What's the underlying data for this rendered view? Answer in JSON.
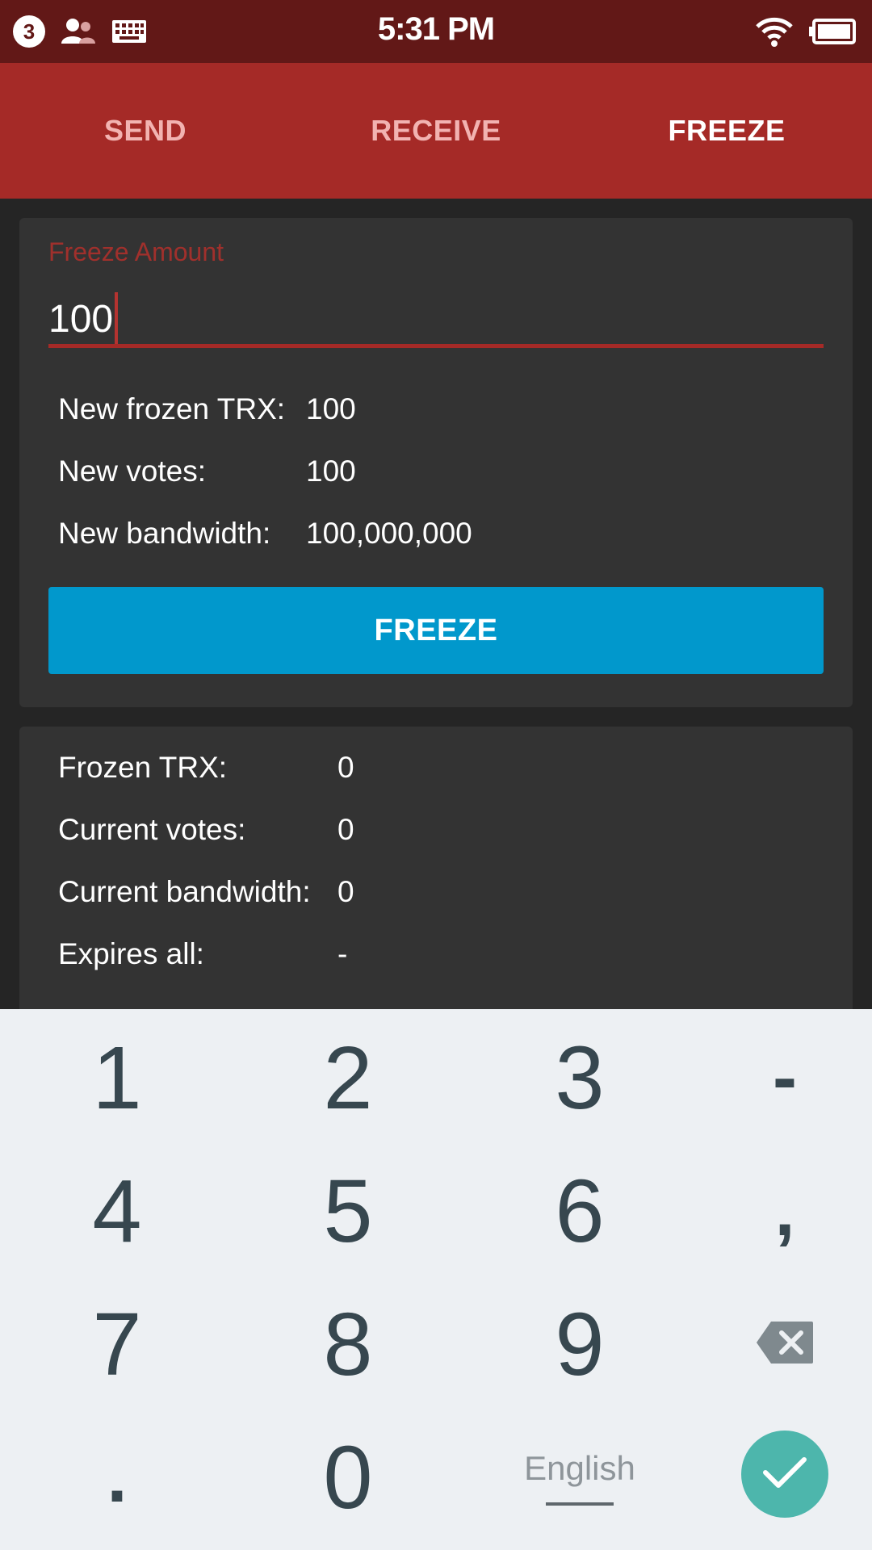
{
  "status_bar": {
    "notification_count": "3",
    "time": "5:31 PM",
    "icons": [
      "contacts-icon",
      "keyboard-icon",
      "wifi-icon",
      "battery-icon"
    ]
  },
  "tabs": [
    {
      "label": "SEND",
      "active": false
    },
    {
      "label": "RECEIVE",
      "active": false
    },
    {
      "label": "FREEZE",
      "active": true
    }
  ],
  "freeze_form": {
    "field_label": "Freeze Amount",
    "amount_value": "100",
    "new_frozen_label": "New frozen TRX:",
    "new_frozen_value": "100",
    "new_votes_label": "New votes:",
    "new_votes_value": "100",
    "new_bandwidth_label": "New bandwidth:",
    "new_bandwidth_value": "100,000,000",
    "button_label": "FREEZE"
  },
  "current": {
    "frozen_label": "Frozen TRX:",
    "frozen_value": "0",
    "votes_label": "Current votes:",
    "votes_value": "0",
    "bandwidth_label": "Current bandwidth:",
    "bandwidth_value": "0",
    "expires_label": "Expires all:",
    "expires_value": "-"
  },
  "keyboard": {
    "keys": [
      "1",
      "2",
      "3",
      "-",
      "4",
      "5",
      "6",
      ",",
      "7",
      "8",
      "9",
      ".",
      "0"
    ],
    "language": "English"
  },
  "colors": {
    "status_bar": "#621817",
    "tab_bar": "#a52a27",
    "accent_red": "#a52a27",
    "button_blue": "#0198cc",
    "done_teal": "#4db6ac",
    "card": "#333333",
    "background": "#252525"
  }
}
